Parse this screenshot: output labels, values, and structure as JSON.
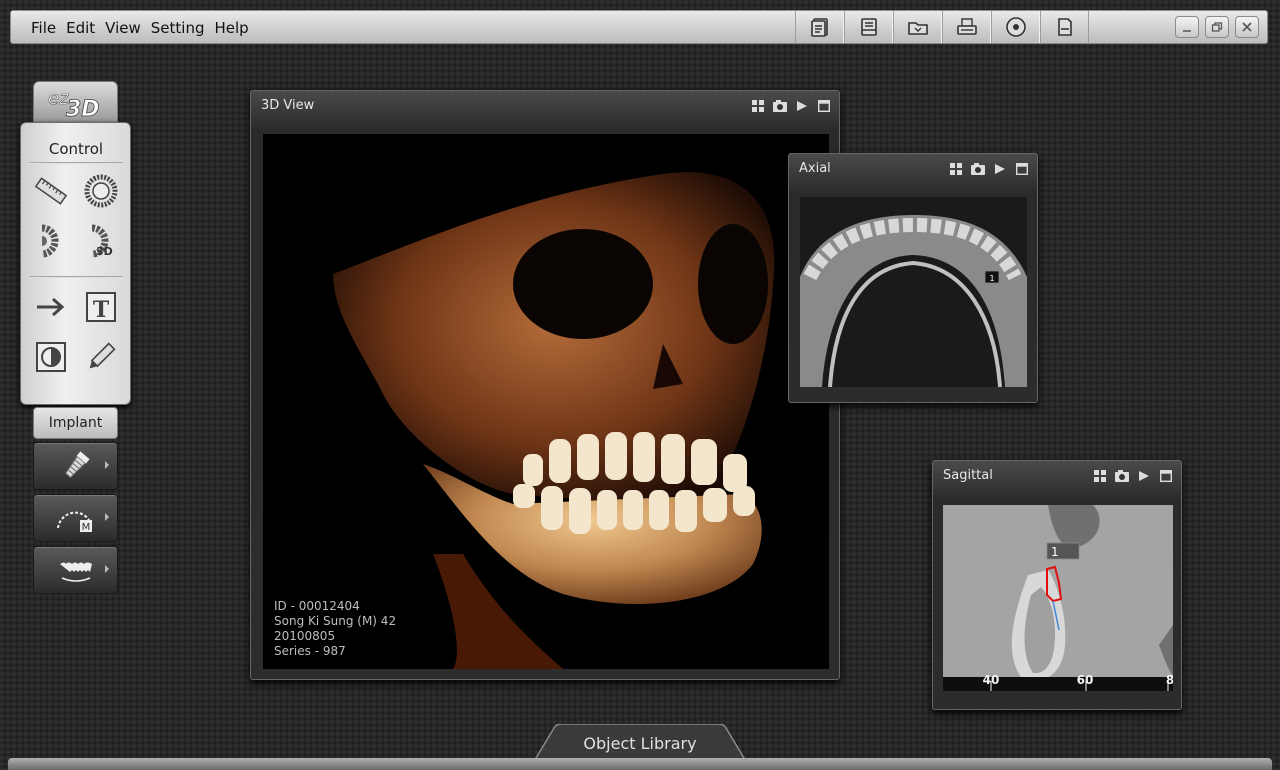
{
  "menu": [
    "File",
    "Edit",
    "View",
    "Setting",
    "Help"
  ],
  "toolbar_icons": [
    "report-icon",
    "save-icon",
    "open-folder-icon",
    "print-icon",
    "cd-icon",
    "document-icon"
  ],
  "window_controls": [
    "minimize-icon",
    "restore-icon",
    "close-icon"
  ],
  "logo": {
    "text_ez": "ez",
    "text_3d": "3D"
  },
  "control": {
    "title": "Control",
    "tools": [
      "ruler-icon",
      "angle-icon",
      "density-icon",
      "density-3d-icon",
      "arrow-icon",
      "text-icon",
      "contrast-icon",
      "pencil-icon"
    ],
    "density_3d_label": "3D",
    "text_tool_label": "T"
  },
  "implant": {
    "title": "Implant",
    "buttons": [
      "implant-icon",
      "nerve-canal-icon",
      "teeth-icon"
    ],
    "nerve_badge": "M"
  },
  "views": {
    "view3d": {
      "title": "3D View"
    },
    "axial": {
      "title": "Axial",
      "marker": "1"
    },
    "sagittal": {
      "title": "Sagittal",
      "marker": "1",
      "ruler": [
        "40",
        "60",
        "8"
      ]
    }
  },
  "patient": {
    "id": "ID - 00012404",
    "name": "Song Ki Sung (M) 42",
    "date": "20100805",
    "series": "Series - 987"
  },
  "object_library": "Object Library"
}
